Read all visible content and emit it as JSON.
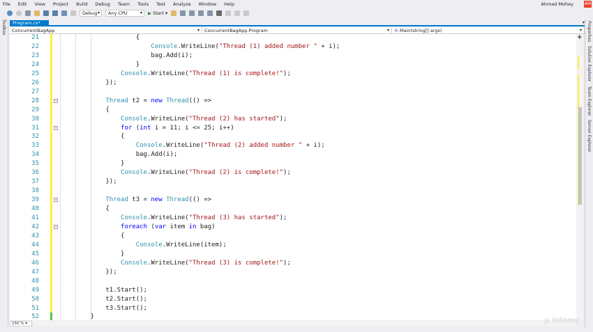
{
  "menu": [
    "File",
    "Edit",
    "View",
    "Project",
    "Build",
    "Debug",
    "Team",
    "Tools",
    "Test",
    "Analyze",
    "Window",
    "Help"
  ],
  "user": {
    "name": "Ahmad Mohey",
    "initials": "AM"
  },
  "toolbar": {
    "config": "Debug",
    "platform": "Any CPU",
    "start": "Start"
  },
  "toolbox_label": "Toolbox",
  "tab": {
    "label": "Program.cs*",
    "pin": "⊕",
    "close": "✕"
  },
  "nav": {
    "project": "ConcurrentBagApp",
    "class": "ConcurrentBagApp.Program",
    "member": "Main(string[] args)"
  },
  "right_dock": [
    "Properties",
    "Solution Explorer",
    "Team Explorer",
    "Server Explorer"
  ],
  "zoom_level": "150 %",
  "watermark": "Udemy",
  "code_lines": [
    {
      "n": "21",
      "i": 16,
      "t": [
        [
          "",
          "{"
        ]
      ]
    },
    {
      "n": "22",
      "i": 20,
      "t": [
        [
          "ty",
          "Console"
        ],
        [
          "",
          ".WriteLine("
        ],
        [
          "st",
          "\"Thread (1) added number \""
        ],
        [
          "",
          " + i);"
        ]
      ]
    },
    {
      "n": "23",
      "i": 20,
      "t": [
        [
          "",
          "bag.Add(i);"
        ]
      ]
    },
    {
      "n": "24",
      "i": 16,
      "t": [
        [
          "",
          "}"
        ]
      ]
    },
    {
      "n": "25",
      "i": 12,
      "t": [
        [
          "ty",
          "Console"
        ],
        [
          "",
          ".WriteLine("
        ],
        [
          "st",
          "\"Thread (1) is complete!\""
        ],
        [
          "",
          ");"
        ]
      ]
    },
    {
      "n": "26",
      "i": 8,
      "t": [
        [
          "",
          "});"
        ]
      ]
    },
    {
      "n": "27",
      "i": 0,
      "t": []
    },
    {
      "n": "28",
      "i": 8,
      "f": 1,
      "t": [
        [
          "ty",
          "Thread"
        ],
        [
          "",
          " t2 = "
        ],
        [
          "kw",
          "new"
        ],
        [
          "",
          " "
        ],
        [
          "ty",
          "Thread"
        ],
        [
          "",
          "(() =>"
        ]
      ]
    },
    {
      "n": "29",
      "i": 8,
      "t": [
        [
          "",
          "{"
        ]
      ]
    },
    {
      "n": "30",
      "i": 12,
      "t": [
        [
          "ty",
          "Console"
        ],
        [
          "",
          ".WriteLine("
        ],
        [
          "st",
          "\"Thread (2) has started\""
        ],
        [
          "",
          ");"
        ]
      ]
    },
    {
      "n": "31",
      "i": 12,
      "f": 1,
      "t": [
        [
          "kw",
          "for"
        ],
        [
          "",
          " ("
        ],
        [
          "kw",
          "int"
        ],
        [
          "",
          " i = 11; i <= 25; i++)"
        ]
      ]
    },
    {
      "n": "32",
      "i": 12,
      "t": [
        [
          "",
          "{"
        ]
      ]
    },
    {
      "n": "33",
      "i": 16,
      "t": [
        [
          "ty",
          "Console"
        ],
        [
          "",
          ".WriteLine("
        ],
        [
          "st",
          "\"Thread (2) added number \""
        ],
        [
          "",
          " + i);"
        ]
      ]
    },
    {
      "n": "34",
      "i": 16,
      "t": [
        [
          "",
          "bag.Add(i);"
        ]
      ]
    },
    {
      "n": "35",
      "i": 12,
      "t": [
        [
          "",
          "}"
        ]
      ]
    },
    {
      "n": "36",
      "i": 12,
      "t": [
        [
          "ty",
          "Console"
        ],
        [
          "",
          ".WriteLine("
        ],
        [
          "st",
          "\"Thread (2) is complete!\""
        ],
        [
          "",
          ");"
        ]
      ]
    },
    {
      "n": "37",
      "i": 8,
      "t": [
        [
          "",
          "});"
        ]
      ]
    },
    {
      "n": "38",
      "i": 0,
      "t": []
    },
    {
      "n": "39",
      "i": 8,
      "f": 1,
      "t": [
        [
          "ty",
          "Thread"
        ],
        [
          "",
          " t3 = "
        ],
        [
          "kw",
          "new"
        ],
        [
          "",
          " "
        ],
        [
          "ty",
          "Thread"
        ],
        [
          "",
          "(() =>"
        ]
      ]
    },
    {
      "n": "40",
      "i": 8,
      "t": [
        [
          "",
          "{"
        ]
      ]
    },
    {
      "n": "41",
      "i": 12,
      "t": [
        [
          "ty",
          "Console"
        ],
        [
          "",
          ".WriteLine("
        ],
        [
          "st",
          "\"Thread (3) has started\""
        ],
        [
          "",
          ");"
        ]
      ]
    },
    {
      "n": "42",
      "i": 12,
      "f": 1,
      "t": [
        [
          "kw",
          "foreach"
        ],
        [
          "",
          " ("
        ],
        [
          "kw",
          "var"
        ],
        [
          "",
          " item "
        ],
        [
          "kw",
          "in"
        ],
        [
          "",
          " bag)"
        ]
      ]
    },
    {
      "n": "43",
      "i": 12,
      "t": [
        [
          "",
          "{"
        ]
      ]
    },
    {
      "n": "44",
      "i": 16,
      "t": [
        [
          "ty",
          "Console"
        ],
        [
          "",
          ".WriteLine(item);"
        ]
      ]
    },
    {
      "n": "45",
      "i": 12,
      "t": [
        [
          "",
          "}"
        ]
      ]
    },
    {
      "n": "46",
      "i": 12,
      "t": [
        [
          "ty",
          "Console"
        ],
        [
          "",
          ".WriteLine("
        ],
        [
          "st",
          "\"Thread (3) is complete!\""
        ],
        [
          "",
          ");"
        ]
      ]
    },
    {
      "n": "47",
      "i": 8,
      "t": [
        [
          "",
          "});"
        ]
      ]
    },
    {
      "n": "48",
      "i": 0,
      "t": []
    },
    {
      "n": "49",
      "i": 8,
      "t": [
        [
          "",
          "t1.Start();"
        ]
      ]
    },
    {
      "n": "50",
      "i": 8,
      "t": [
        [
          "",
          "t2.Start();"
        ]
      ]
    },
    {
      "n": "51",
      "i": 8,
      "t": [
        [
          "",
          "t3.Start();"
        ]
      ]
    },
    {
      "n": "52",
      "i": 4,
      "saved": true,
      "t": [
        [
          "",
          "}"
        ]
      ]
    }
  ],
  "colors": {
    "accent": "#007acc",
    "keyword": "#0000ff",
    "type": "#2b91af",
    "string": "#a31515",
    "changed": "#ffee3b",
    "saved": "#57c24e"
  }
}
